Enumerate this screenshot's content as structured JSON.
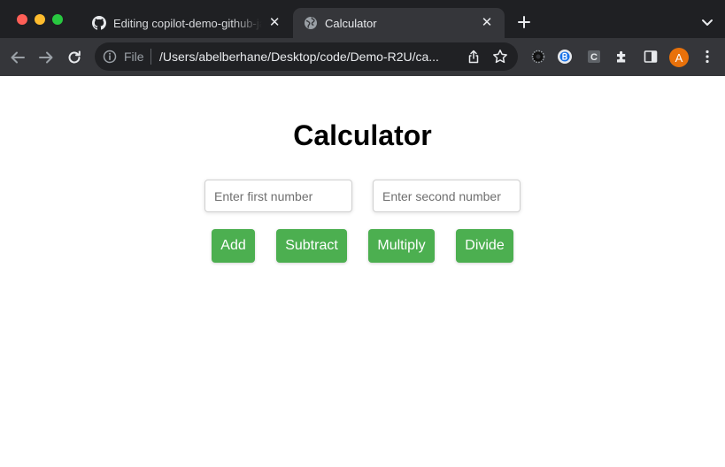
{
  "browser": {
    "tabs": [
      {
        "title": "Editing copilot-demo-github-ja",
        "favicon": "github-icon",
        "active": false
      },
      {
        "title": "Calculator",
        "favicon": "globe-icon",
        "active": true
      }
    ],
    "address_bar": {
      "scheme_label": "File",
      "url": "/Users/abelberhane/Desktop/code/Demo-R2U/ca..."
    },
    "extensions": [
      {
        "name": "gear-extension-icon"
      },
      {
        "name": "b-extension-icon"
      },
      {
        "name": "c-extension-icon",
        "label": "C"
      },
      {
        "name": "puzzle-extensions-icon"
      }
    ],
    "profile": {
      "initial": "A",
      "color": "#e8710a"
    }
  },
  "page": {
    "title": "Calculator",
    "inputs": {
      "first": {
        "value": "",
        "placeholder": "Enter first number"
      },
      "second": {
        "value": "",
        "placeholder": "Enter second number"
      }
    },
    "buttons": {
      "add": "Add",
      "subtract": "Subtract",
      "multiply": "Multiply",
      "divide": "Divide"
    },
    "button_color": "#4caf50"
  }
}
